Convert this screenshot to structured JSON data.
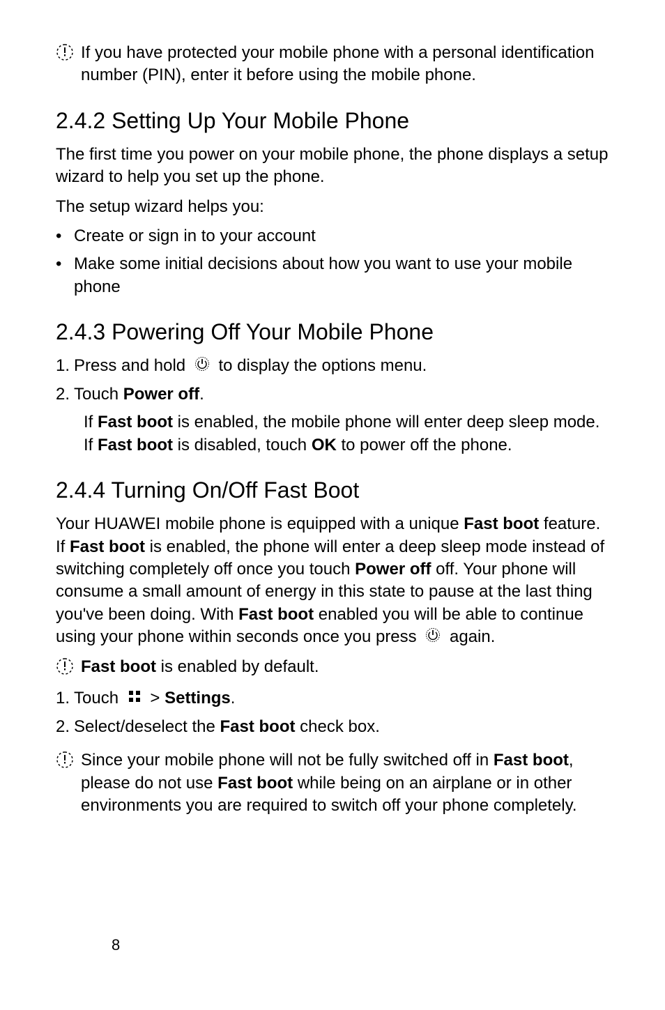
{
  "blocks": {
    "note1": "If you have protected your mobile phone with a personal identification number (PIN), enter it before using the mobile phone.",
    "h_242": "2.4.2  Setting Up Your Mobile Phone",
    "p_242a": "The first time you power on your mobile phone, the phone displays a setup wizard to help you set up the phone.",
    "p_242b": "The setup wizard helps you:",
    "li_242_1": "Create or sign in to your account",
    "li_242_2": "Make some initial decisions about how you want to use your mobile phone",
    "h_243": "2.4.3  Powering Off Your Mobile Phone",
    "step_243_1_pre": "Press and hold ",
    "step_243_1_post": " to display the options menu.",
    "step_243_2_pre": "Touch ",
    "step_243_2_bold": "Power off",
    "step_243_2_post": ".",
    "ind_243_a": "If ",
    "ind_243_b": "Fast boot",
    "ind_243_c": " is enabled, the mobile phone will enter deep sleep mode. If ",
    "ind_243_d": "Fast boot",
    "ind_243_e": " is disabled, touch ",
    "ind_243_f": "OK",
    "ind_243_g": " to power off the phone.",
    "h_244": "2.4.4  Turning On/Off Fast Boot",
    "p_244_a": "Your HUAWEI mobile phone is equipped with a unique ",
    "p_244_b": "Fast boot",
    "p_244_c": " feature.",
    "p_244_d": "If ",
    "p_244_e": "Fast boot",
    "p_244_f": " is enabled, the phone will enter a deep sleep mode instead of switching completely off once you touch ",
    "p_244_g": "Power off",
    "p_244_h": " off. Your phone will consume a small amount of energy in this state to pause at the last thing you've been doing. With ",
    "p_244_i": "Fast boot",
    "p_244_j": " enabled you will be able to continue using your phone within seconds once you press ",
    "p_244_k": " again.",
    "note2_a": "Fast boot",
    "note2_b": " is enabled by default.",
    "step_244_1_pre": "Touch ",
    "step_244_1_gt": " > ",
    "step_244_1_bold": "Settings",
    "step_244_1_post": ".",
    "step_244_2_a": "Select/deselect the ",
    "step_244_2_b": "Fast boot",
    "step_244_2_c": " check box.",
    "note3_a": "Since your mobile phone will not be fully switched off in ",
    "note3_b": "Fast boot",
    "note3_c": ", please do not use ",
    "note3_d": "Fast boot",
    "note3_e": " while being on an airplane or in other environments you are required to switch off your phone completely.",
    "page_num": "8"
  },
  "nums": {
    "one": "1.",
    "two": "2."
  },
  "bullet": "•"
}
